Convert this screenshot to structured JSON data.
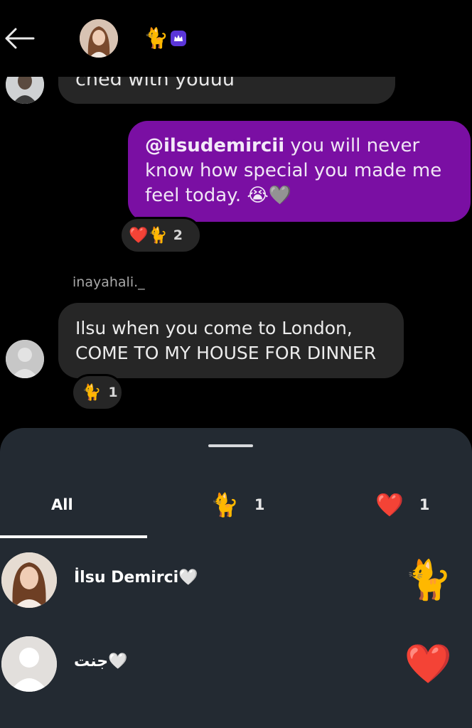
{
  "header": {
    "emoji": "🐈",
    "badge_icon": "crown-badge-icon"
  },
  "messages": {
    "previous_text": "ched with youuu",
    "mine": {
      "mention": "@ilsudemircii",
      "text": " you will never know how special you made me feel today. 😭🩶",
      "reactions": {
        "emojis": "❤️🐈",
        "count": "2"
      }
    },
    "other": {
      "sender": "inayahali._",
      "text": "Ilsu when you come to London, COME TO MY HOUSE FOR DINNER",
      "reactions": {
        "emojis": "🐈",
        "count": "1"
      }
    }
  },
  "sheet": {
    "tabs": [
      {
        "label": "All"
      },
      {
        "emoji": "🐈",
        "count": "1"
      },
      {
        "emoji": "❤️",
        "count": "1"
      }
    ],
    "reactors": [
      {
        "name": "İlsu Demirci🤍",
        "reaction": "🐈"
      },
      {
        "name": "جنت🤍",
        "reaction": "❤️"
      }
    ]
  },
  "colors": {
    "background": "#000000",
    "my_bubble": "#7a0fa3",
    "other_bubble": "#262626",
    "sheet": "#232a32"
  }
}
